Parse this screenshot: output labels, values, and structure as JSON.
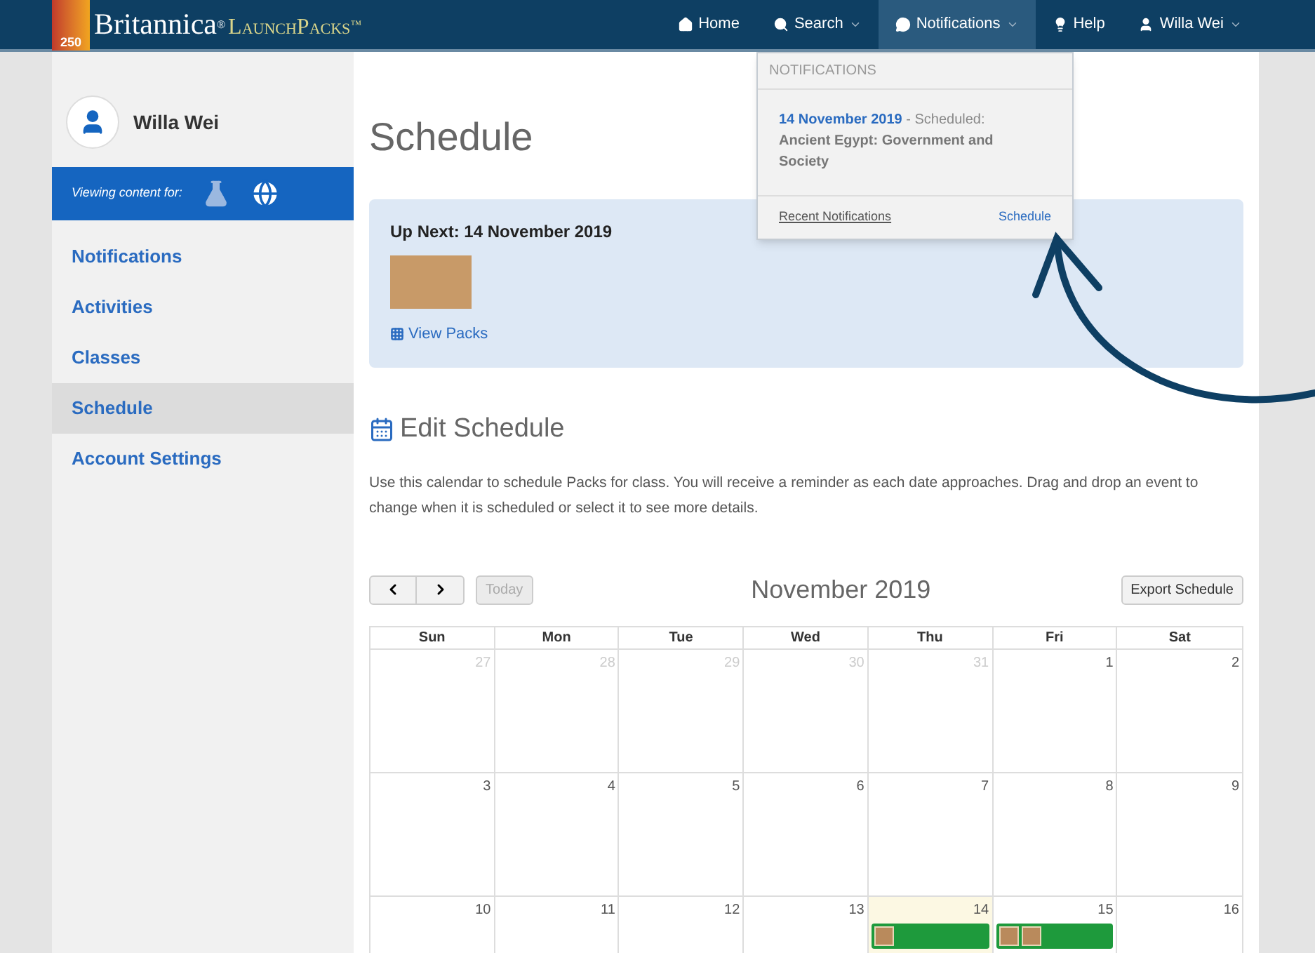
{
  "brand": {
    "emblem": "250",
    "name": "Britannica",
    "reg": "®",
    "product": "LaunchPacks",
    "tm": "™"
  },
  "nav": [
    {
      "label": "Home",
      "caret": false,
      "selected": false
    },
    {
      "label": "Search",
      "caret": true,
      "selected": false
    },
    {
      "label": "Notifications",
      "caret": true,
      "selected": true
    },
    {
      "label": "Help",
      "caret": false,
      "selected": false
    },
    {
      "label": "Willa Wei",
      "caret": true,
      "selected": false
    }
  ],
  "notifications_menu": {
    "header": "NOTIFICATIONS",
    "item": {
      "date": "14 November 2019",
      "separator": " - Scheduled:",
      "title": "Ancient Egypt: Government and Society"
    },
    "footer_left": "Recent Notifications",
    "footer_right": "Schedule"
  },
  "sidebar": {
    "user": "Willa Wei",
    "viewing_label": "Viewing content for:",
    "items": [
      {
        "label": "Notifications",
        "selected": false
      },
      {
        "label": "Activities",
        "selected": false
      },
      {
        "label": "Classes",
        "selected": false
      },
      {
        "label": "Schedule",
        "selected": true
      },
      {
        "label": "Account Settings",
        "selected": false
      }
    ]
  },
  "page_title": "Schedule",
  "up_next": {
    "title": "Up Next: 14 November 2019",
    "link": "View Packs"
  },
  "edit_heading": "Edit Schedule",
  "description": "Use this calendar to schedule Packs for class. You will receive a reminder as each date approaches. Drag and drop an event to change when it is scheduled or select it to see more details.",
  "calendar": {
    "today_button": {
      "label": "Today",
      "disabled": true
    },
    "month": "November 2019",
    "export": "Export Schedule",
    "weekdays": [
      "Sun",
      "Mon",
      "Tue",
      "Wed",
      "Thu",
      "Fri",
      "Sat"
    ],
    "weeks": [
      [
        {
          "day": "27",
          "muted": true,
          "today": false
        },
        {
          "day": "28",
          "muted": true,
          "today": false
        },
        {
          "day": "29",
          "muted": true,
          "today": false
        },
        {
          "day": "30",
          "muted": true,
          "today": false
        },
        {
          "day": "31",
          "muted": true,
          "today": false
        },
        {
          "day": "1",
          "muted": false,
          "today": false
        },
        {
          "day": "2",
          "muted": false,
          "today": false
        }
      ],
      [
        {
          "day": "3",
          "muted": false,
          "today": false
        },
        {
          "day": "4",
          "muted": false,
          "today": false
        },
        {
          "day": "5",
          "muted": false,
          "today": false
        },
        {
          "day": "6",
          "muted": false,
          "today": false
        },
        {
          "day": "7",
          "muted": false,
          "today": false
        },
        {
          "day": "8",
          "muted": false,
          "today": false
        },
        {
          "day": "9",
          "muted": false,
          "today": false
        }
      ],
      [
        {
          "day": "10",
          "muted": false,
          "today": false
        },
        {
          "day": "11",
          "muted": false,
          "today": false
        },
        {
          "day": "12",
          "muted": false,
          "today": false
        },
        {
          "day": "13",
          "muted": false,
          "today": false
        },
        {
          "day": "14",
          "muted": false,
          "today": true,
          "events": [
            {
              "images": [
                {
                  "kind": "photo"
                }
              ]
            }
          ]
        },
        {
          "day": "15",
          "muted": false,
          "today": false,
          "events": [
            {
              "images": [
                {
                  "kind": "photo"
                },
                {
                  "kind": "photo"
                }
              ]
            }
          ]
        },
        {
          "day": "16",
          "muted": false,
          "today": false
        }
      ]
    ]
  }
}
